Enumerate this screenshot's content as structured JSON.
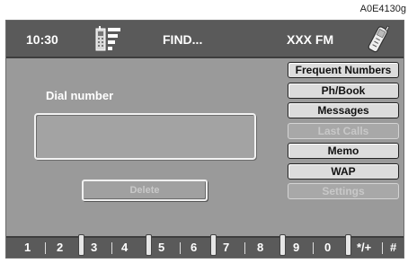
{
  "corner_code": "A0E4130g",
  "status": {
    "time": "10:30",
    "find_label": "FIND...",
    "radio_label": "XXX FM",
    "signal_icon": "signal-strength-icon",
    "phone_icon": "mobile-phone-icon"
  },
  "dial": {
    "label": "Dial number",
    "value": "",
    "delete_label": "Delete"
  },
  "menu": [
    {
      "label": "Frequent Numbers",
      "enabled": true
    },
    {
      "label": "Ph/Book",
      "enabled": true
    },
    {
      "label": "Messages",
      "enabled": true
    },
    {
      "label": "Last Calls",
      "enabled": false
    },
    {
      "label": "Memo",
      "enabled": true
    },
    {
      "label": "WAP",
      "enabled": true
    },
    {
      "label": "Settings",
      "enabled": false
    }
  ],
  "keypad": [
    "1",
    "2",
    "3",
    "4",
    "5",
    "6",
    "7",
    "8",
    "9",
    "0",
    "*/+",
    "#"
  ],
  "colors": {
    "panel": "#9a9a9a",
    "bar": "#5a5a5a",
    "button": "#dcdcdc",
    "text_light": "#ffffff"
  }
}
